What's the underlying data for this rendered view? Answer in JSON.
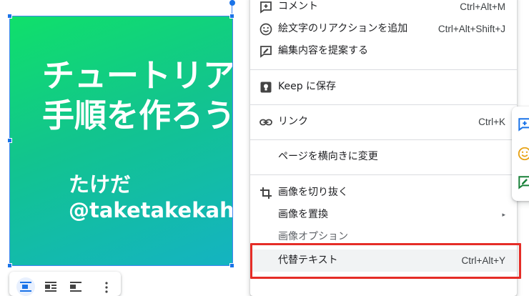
{
  "slide": {
    "title_lines": [
      "チュートリアル",
      "手順を作ろう"
    ],
    "author_lines": [
      "たけだ",
      "@taketakekaho"
    ]
  },
  "context_menu": {
    "items": [
      {
        "label": "コメント",
        "shortcut": "Ctrl+Alt+M",
        "icon": "add-comment-icon"
      },
      {
        "label": "絵文字のリアクションを追加",
        "shortcut": "Ctrl+Alt+Shift+J",
        "icon": "emoji-icon"
      },
      {
        "label": "編集内容を提案する",
        "shortcut": "",
        "icon": "suggest-edit-icon"
      },
      {
        "label": "Keep に保存",
        "shortcut": "",
        "icon": "keep-icon"
      },
      {
        "label": "リンク",
        "shortcut": "Ctrl+K",
        "icon": "link-icon"
      },
      {
        "label": "ページを横向きに変更",
        "shortcut": "",
        "icon": ""
      },
      {
        "label": "画像を切り抜く",
        "shortcut": "",
        "icon": "crop-icon"
      },
      {
        "label": "画像を置換",
        "shortcut": "",
        "icon": "",
        "submenu": "▸"
      },
      {
        "label": "画像オプション",
        "shortcut": "",
        "icon": ""
      },
      {
        "label": "代替テキスト",
        "shortcut": "Ctrl+Alt+Y",
        "icon": "",
        "highlighted": true
      }
    ]
  },
  "colors": {
    "selection": "#1a73e8",
    "annotation_box": "#e52d27",
    "gradient_start": "#10e06a",
    "gradient_end": "#14b3c2"
  },
  "image_toolbar": {
    "buttons": [
      "inline-icon",
      "wrap-text-icon",
      "break-text-icon",
      "more-vert-icon"
    ]
  },
  "side_actions": {
    "buttons": [
      "add-comment-icon",
      "emoji-icon",
      "suggest-edit-icon"
    ]
  }
}
